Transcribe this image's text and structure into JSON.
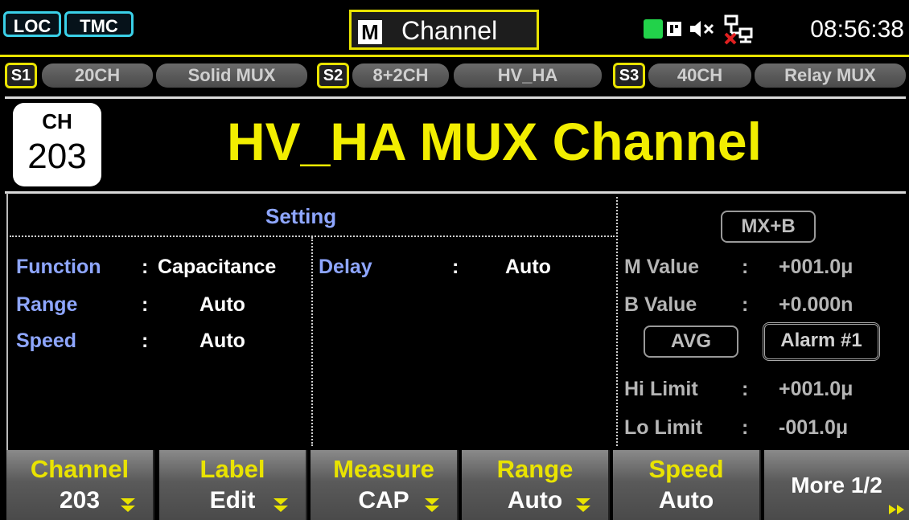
{
  "status_bar": {
    "loc": "LOC",
    "tmc": "TMC",
    "mode_letter": "M",
    "mode_label": "Channel",
    "time": "08:56:38",
    "icons": [
      "display-icon",
      "mute-icon",
      "network-disconnected-icon"
    ]
  },
  "slots": [
    {
      "id": "S1",
      "channels": "20CH",
      "type": "Solid MUX"
    },
    {
      "id": "S2",
      "channels": "8+2CH",
      "type": "HV_HA"
    },
    {
      "id": "S3",
      "channels": "40CH",
      "type": "Relay MUX"
    }
  ],
  "channel": {
    "badge_label": "CH",
    "badge_number": "203",
    "title": "HV_HA MUX Channel"
  },
  "setting": {
    "header": "Setting",
    "rows": [
      {
        "label": "Function",
        "sep": ":",
        "value": "Capacitance"
      },
      {
        "label": "Range",
        "sep": ":",
        "value": "Auto"
      },
      {
        "label": "Speed",
        "sep": ":",
        "value": "Auto"
      }
    ],
    "delay": {
      "label": "Delay",
      "sep": ":",
      "value": "Auto"
    }
  },
  "right_panel": {
    "mxb_button": "MX+B",
    "m_value": {
      "label": "M Value",
      "sep": ":",
      "value": "+001.0μ"
    },
    "b_value": {
      "label": "B Value",
      "sep": ":",
      "value": "+0.000n"
    },
    "avg_button": "AVG",
    "alarm_button": "Alarm #1",
    "hi_limit": {
      "label": "Hi Limit",
      "sep": ":",
      "value": "+001.0μ"
    },
    "lo_limit": {
      "label": "Lo Limit",
      "sep": ":",
      "value": "-001.0μ"
    }
  },
  "softkeys": [
    {
      "title": "Channel",
      "value": "203",
      "has_arrow": true
    },
    {
      "title": "Label",
      "value": "Edit",
      "has_arrow": true
    },
    {
      "title": "Measure",
      "value": "CAP",
      "has_arrow": true
    },
    {
      "title": "Range",
      "value": "Auto",
      "has_arrow": true
    },
    {
      "title": "Speed",
      "value": "Auto",
      "has_arrow": false
    },
    {
      "title": "",
      "value": "More 1/2",
      "has_arrow": false
    }
  ],
  "colors": {
    "accent_yellow": "#e9e300",
    "label_blue": "#8ea6ff",
    "tag_cyan": "#3ad0e8",
    "title_yellow": "#f2ee00",
    "status_green": "#22d24a",
    "disconnect_red": "#e02020"
  }
}
